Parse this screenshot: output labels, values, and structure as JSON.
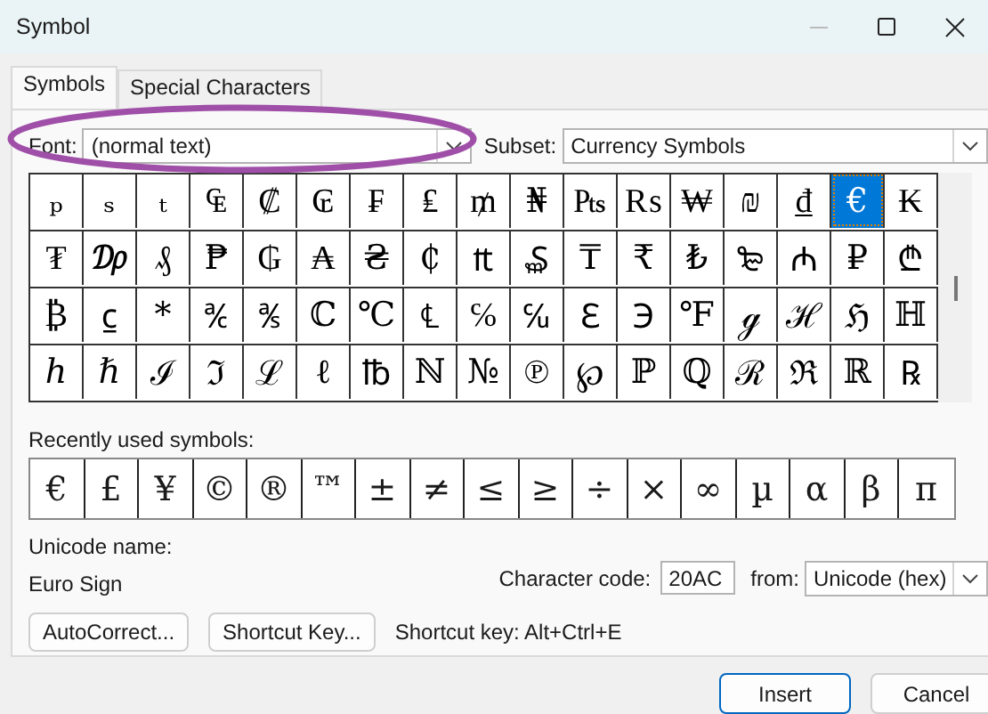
{
  "window": {
    "title": "Symbol"
  },
  "tabs": [
    {
      "label": "Symbols",
      "selected": true
    },
    {
      "label": "Special Characters",
      "selected": false
    }
  ],
  "font_field": {
    "label": "Font:",
    "value": "(normal text)"
  },
  "subset_field": {
    "label": "Subset:",
    "value": "Currency Symbols"
  },
  "symbol_grid": [
    [
      {
        "char": "ₚ",
        "selected": false
      },
      {
        "char": "ₛ",
        "selected": false
      },
      {
        "char": "ₜ",
        "selected": false
      },
      {
        "char": "₠",
        "selected": false
      },
      {
        "char": "₡",
        "selected": false
      },
      {
        "char": "₢",
        "selected": false
      },
      {
        "char": "₣",
        "selected": false
      },
      {
        "char": "₤",
        "selected": false
      },
      {
        "char": "₥",
        "selected": false
      },
      {
        "char": "₦",
        "selected": false
      },
      {
        "char": "₧",
        "selected": false
      },
      {
        "char": "₨",
        "selected": false
      },
      {
        "char": "₩",
        "selected": false
      },
      {
        "char": "₪",
        "selected": false
      },
      {
        "char": "₫",
        "selected": false
      },
      {
        "char": "€",
        "selected": true
      },
      {
        "char": "₭",
        "selected": false
      }
    ],
    [
      {
        "char": "₮",
        "selected": false
      },
      {
        "char": "₯",
        "selected": false
      },
      {
        "char": "₰",
        "selected": false
      },
      {
        "char": "₱",
        "selected": false
      },
      {
        "char": "₲",
        "selected": false
      },
      {
        "char": "₳",
        "selected": false
      },
      {
        "char": "₴",
        "selected": false
      },
      {
        "char": "₵",
        "selected": false
      },
      {
        "char": "₶",
        "selected": false
      },
      {
        "char": "₷",
        "selected": false
      },
      {
        "char": "₸",
        "selected": false
      },
      {
        "char": "₹",
        "selected": false
      },
      {
        "char": "₺",
        "selected": false
      },
      {
        "char": "₻",
        "selected": false
      },
      {
        "char": "₼",
        "selected": false
      },
      {
        "char": "₽",
        "selected": false
      },
      {
        "char": "₾",
        "selected": false
      }
    ],
    [
      {
        "char": "₿",
        "selected": false
      },
      {
        "char": "⃀",
        "selected": false
      },
      {
        "char": "*",
        "selected": false
      },
      {
        "char": "℀",
        "selected": false
      },
      {
        "char": "℁",
        "selected": false
      },
      {
        "char": "ℂ",
        "selected": false
      },
      {
        "char": "℃",
        "selected": false
      },
      {
        "char": "℄",
        "selected": false
      },
      {
        "char": "℅",
        "selected": false
      },
      {
        "char": "℆",
        "selected": false
      },
      {
        "char": "ℇ",
        "selected": false
      },
      {
        "char": "℈",
        "selected": false
      },
      {
        "char": "℉",
        "selected": false
      },
      {
        "char": "ℊ",
        "selected": false
      },
      {
        "char": "ℋ",
        "selected": false
      },
      {
        "char": "ℌ",
        "selected": false
      },
      {
        "char": "ℍ",
        "selected": false
      }
    ],
    [
      {
        "char": "ℎ",
        "selected": false
      },
      {
        "char": "ℏ",
        "selected": false
      },
      {
        "char": "ℐ",
        "selected": false
      },
      {
        "char": "ℑ",
        "selected": false
      },
      {
        "char": "ℒ",
        "selected": false
      },
      {
        "char": "ℓ",
        "selected": false
      },
      {
        "char": "℔",
        "selected": false
      },
      {
        "char": "ℕ",
        "selected": false
      },
      {
        "char": "№",
        "selected": false
      },
      {
        "char": "℗",
        "selected": false
      },
      {
        "char": "℘",
        "selected": false
      },
      {
        "char": "ℙ",
        "selected": false
      },
      {
        "char": "ℚ",
        "selected": false
      },
      {
        "char": "ℛ",
        "selected": false
      },
      {
        "char": "ℜ",
        "selected": false
      },
      {
        "char": "ℝ",
        "selected": false
      },
      {
        "char": "℞",
        "selected": false
      }
    ]
  ],
  "recently_used": {
    "label": "Recently used symbols:",
    "symbols": [
      "€",
      "£",
      "¥",
      "©",
      "®",
      "™",
      "±",
      "≠",
      "≤",
      "≥",
      "÷",
      "×",
      "∞",
      "µ",
      "α",
      "β",
      "π"
    ]
  },
  "unicode_name": {
    "label": "Unicode name:",
    "value": "Euro Sign"
  },
  "character_code": {
    "label": "Character code:",
    "value": "20AC"
  },
  "from_field": {
    "label": "from:",
    "value": "Unicode (hex)"
  },
  "action_buttons": [
    "AutoCorrect...",
    "Shortcut Key..."
  ],
  "shortcut_key": "Shortcut key: Alt+Ctrl+E",
  "dialog_buttons": [
    {
      "label": "Insert",
      "default": true
    },
    {
      "label": "Cancel",
      "default": false
    }
  ],
  "annotation": {
    "kind": "ellipse"
  }
}
